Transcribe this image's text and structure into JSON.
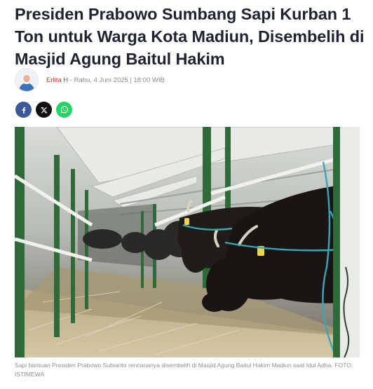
{
  "article": {
    "title": "Presiden Prabowo Sumbang Sapi Kurban 1 Ton untuk Warga Kota Madiun, Disembelih di Masjid Agung Baitul Hakim",
    "author": "Erlita H",
    "date_text": " - Rabu, 4 Juni 2025 | 18:00 WIB"
  },
  "share": {
    "buttons": [
      {
        "name": "facebook",
        "icon": "facebook-icon",
        "color": "#3b5998"
      },
      {
        "name": "x",
        "icon": "x-icon",
        "color": "#111111"
      },
      {
        "name": "whatsapp",
        "icon": "whatsapp-icon",
        "color": "#25d366"
      }
    ]
  },
  "photo": {
    "caption": "Sapi bantuan Presiden Prabowo Subianto rencananya disembelih di Masjid Agung Baitul Hakim Madiun saat Idul Adha. FOTO: ISTIMEWA"
  },
  "colors": {
    "headline": "#1f2330",
    "author": "#c0342b",
    "meta": "#8a8a8a",
    "caption": "#8e8e8e"
  }
}
